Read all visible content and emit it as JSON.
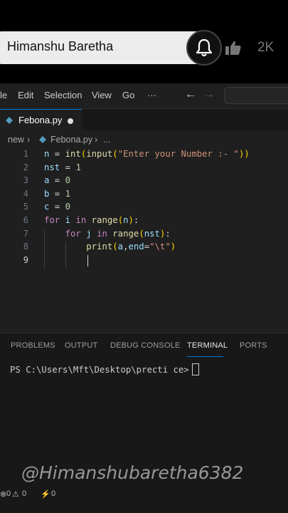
{
  "overlay": {
    "channel_name": "Himanshu Baretha",
    "like_count": "2K",
    "watermark": "@Himanshubaretha6382"
  },
  "menu": {
    "items": [
      "le",
      "Edit",
      "Selection",
      "View",
      "Go",
      "···"
    ]
  },
  "tab": {
    "filename": "Febona.py"
  },
  "breadcrumb": {
    "folder": "new",
    "file": "Febona.py",
    "more": "..."
  },
  "editor": {
    "line_numbers": [
      "1",
      "2",
      "3",
      "4",
      "5",
      "6",
      "7",
      "8",
      "9"
    ],
    "lines": [
      "n = int(input(\"Enter your Number :- \"))",
      "nst = 1",
      "a = 0",
      "b = 1",
      "c = 0",
      "for i in range(n):",
      "    for j in range(nst):",
      "        print(a,end=\"\\t\")",
      ""
    ]
  },
  "panel": {
    "tabs": [
      "PROBLEMS",
      "OUTPUT",
      "DEBUG CONSOLE",
      "TERMINAL",
      "PORTS"
    ],
    "active_tab": "TERMINAL",
    "terminal_prompt": "PS C:\\Users\\Mft\\Desktop\\precti ce> "
  },
  "status": {
    "errors": "0",
    "warnings": "0",
    "ports": "0"
  },
  "colors": {
    "accent": "#0078d4",
    "editor_bg": "#1f1f1f",
    "keyword": "#c586c0",
    "function": "#dcdcaa",
    "string": "#ce9178"
  }
}
